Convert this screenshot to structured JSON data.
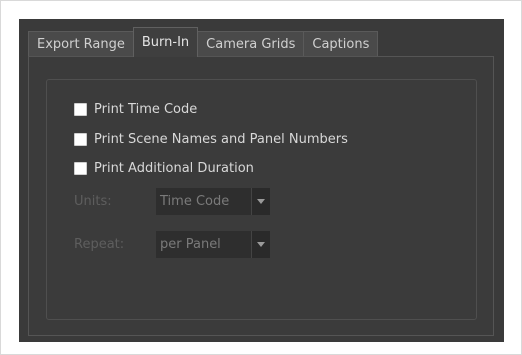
{
  "tabs": [
    {
      "label": "Export Range"
    },
    {
      "label": "Burn-In"
    },
    {
      "label": "Camera Grids"
    },
    {
      "label": "Captions"
    }
  ],
  "active_tab": "Burn-In",
  "checkboxes": [
    {
      "label": "Print Time Code",
      "checked": false
    },
    {
      "label": "Print Scene Names and Panel Numbers",
      "checked": false
    },
    {
      "label": "Print Additional Duration",
      "checked": false
    }
  ],
  "units": {
    "label": "Units:",
    "value": "Time Code",
    "enabled": false
  },
  "repeat": {
    "label": "Repeat:",
    "value": "per Panel",
    "enabled": false
  }
}
